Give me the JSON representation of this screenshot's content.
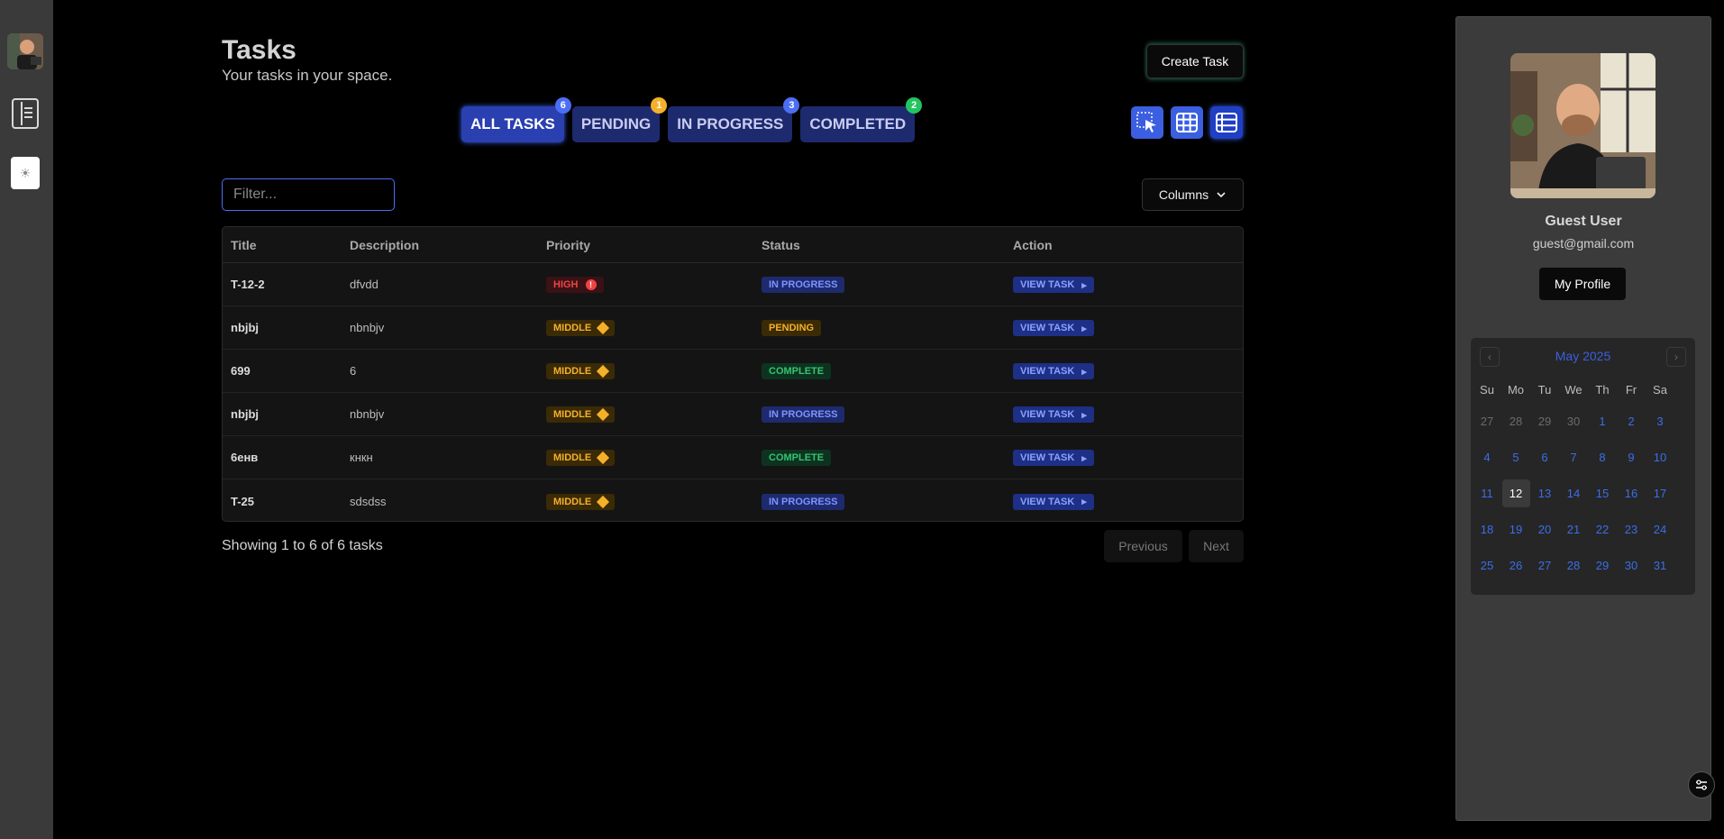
{
  "header": {
    "title": "Tasks",
    "subtitle": "Your tasks in your space."
  },
  "create_button": "Create Task",
  "tabs": [
    {
      "label": "ALL TASKS",
      "count": "6",
      "color": "#4c6ef5",
      "active": true
    },
    {
      "label": "PENDING",
      "count": "1",
      "color": "#f5b02a",
      "active": false
    },
    {
      "label": "IN PROGRESS",
      "count": "3",
      "color": "#4c6ef5",
      "active": false
    },
    {
      "label": "COMPLETED",
      "count": "2",
      "color": "#22c55e",
      "active": false
    }
  ],
  "filter": {
    "placeholder": "Filter...",
    "value": ""
  },
  "columns_button": "Columns",
  "table": {
    "headers": [
      "Title",
      "Description",
      "Priority",
      "Status",
      "Action"
    ],
    "rows": [
      {
        "title": "T-12-2",
        "description": "dfvdd",
        "priority": "HIGH",
        "status": "IN PROGRESS",
        "action": "VIEW TASK"
      },
      {
        "title": "nbjbj",
        "description": "nbnbjv",
        "priority": "MIDDLE",
        "status": "PENDING",
        "action": "VIEW TASK"
      },
      {
        "title": "699",
        "description": "6",
        "priority": "MIDDLE",
        "status": "COMPLETE",
        "action": "VIEW TASK"
      },
      {
        "title": "nbjbj",
        "description": "nbnbjv",
        "priority": "MIDDLE",
        "status": "IN PROGRESS",
        "action": "VIEW TASK"
      },
      {
        "title": "6енв",
        "description": "кнкн",
        "priority": "MIDDLE",
        "status": "COMPLETE",
        "action": "VIEW TASK"
      },
      {
        "title": "T-25",
        "description": "sdsdss",
        "priority": "MIDDLE",
        "status": "IN PROGRESS",
        "action": "VIEW TASK"
      }
    ]
  },
  "footer": {
    "showing": "Showing 1 to 6 of 6 tasks",
    "previous": "Previous",
    "next": "Next"
  },
  "profile": {
    "name": "Guest User",
    "email": "guest@gmail.com",
    "button": "My Profile"
  },
  "calendar": {
    "month": "May 2025",
    "weekdays": [
      "Su",
      "Mo",
      "Tu",
      "We",
      "Th",
      "Fr",
      "Sa"
    ],
    "days": [
      [
        "27",
        "28",
        "29",
        "30",
        "1",
        "2",
        "3"
      ],
      [
        "4",
        "5",
        "6",
        "7",
        "8",
        "9",
        "10"
      ],
      [
        "11",
        "12",
        "13",
        "14",
        "15",
        "16",
        "17"
      ],
      [
        "18",
        "19",
        "20",
        "21",
        "22",
        "23",
        "24"
      ],
      [
        "25",
        "26",
        "27",
        "28",
        "29",
        "30",
        "31"
      ]
    ],
    "today": "12"
  },
  "icons": {
    "sidebar_toggle": "list-icon",
    "theme": "sun-icon",
    "view_modes": [
      "select-icon",
      "grid-icon",
      "list-icon"
    ],
    "chevron": "chevron-down-icon",
    "corner": "settings-toggle-icon"
  }
}
